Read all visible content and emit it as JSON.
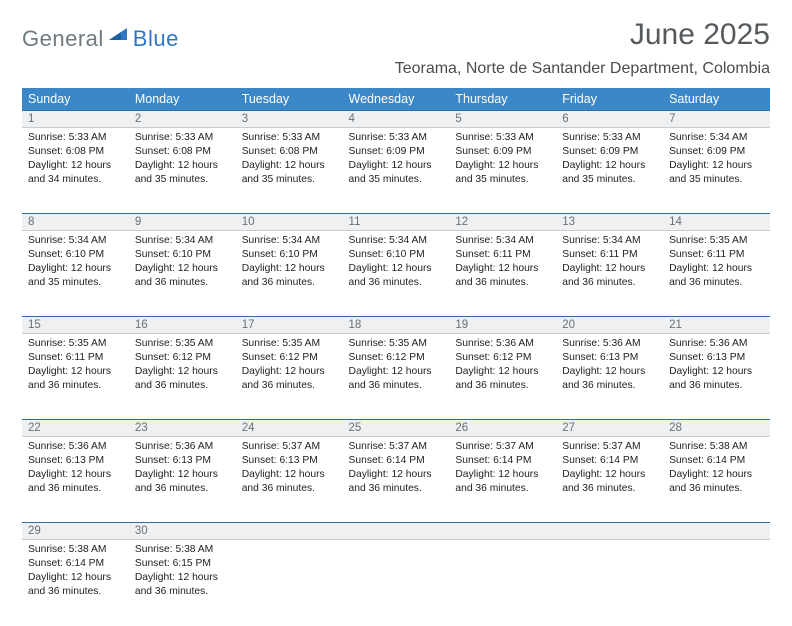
{
  "logo": {
    "text1": "General",
    "text2": "Blue"
  },
  "title": "June 2025",
  "location": "Teorama, Norte de Santander Department, Colombia",
  "weekdays": [
    "Sunday",
    "Monday",
    "Tuesday",
    "Wednesday",
    "Thursday",
    "Friday",
    "Saturday"
  ],
  "weeks": [
    [
      {
        "day": "1",
        "sunrise": "Sunrise: 5:33 AM",
        "sunset": "Sunset: 6:08 PM",
        "day1": "Daylight: 12 hours",
        "day2": "and 34 minutes."
      },
      {
        "day": "2",
        "sunrise": "Sunrise: 5:33 AM",
        "sunset": "Sunset: 6:08 PM",
        "day1": "Daylight: 12 hours",
        "day2": "and 35 minutes."
      },
      {
        "day": "3",
        "sunrise": "Sunrise: 5:33 AM",
        "sunset": "Sunset: 6:08 PM",
        "day1": "Daylight: 12 hours",
        "day2": "and 35 minutes."
      },
      {
        "day": "4",
        "sunrise": "Sunrise: 5:33 AM",
        "sunset": "Sunset: 6:09 PM",
        "day1": "Daylight: 12 hours",
        "day2": "and 35 minutes."
      },
      {
        "day": "5",
        "sunrise": "Sunrise: 5:33 AM",
        "sunset": "Sunset: 6:09 PM",
        "day1": "Daylight: 12 hours",
        "day2": "and 35 minutes."
      },
      {
        "day": "6",
        "sunrise": "Sunrise: 5:33 AM",
        "sunset": "Sunset: 6:09 PM",
        "day1": "Daylight: 12 hours",
        "day2": "and 35 minutes."
      },
      {
        "day": "7",
        "sunrise": "Sunrise: 5:34 AM",
        "sunset": "Sunset: 6:09 PM",
        "day1": "Daylight: 12 hours",
        "day2": "and 35 minutes."
      }
    ],
    [
      {
        "day": "8",
        "sunrise": "Sunrise: 5:34 AM",
        "sunset": "Sunset: 6:10 PM",
        "day1": "Daylight: 12 hours",
        "day2": "and 35 minutes."
      },
      {
        "day": "9",
        "sunrise": "Sunrise: 5:34 AM",
        "sunset": "Sunset: 6:10 PM",
        "day1": "Daylight: 12 hours",
        "day2": "and 36 minutes."
      },
      {
        "day": "10",
        "sunrise": "Sunrise: 5:34 AM",
        "sunset": "Sunset: 6:10 PM",
        "day1": "Daylight: 12 hours",
        "day2": "and 36 minutes."
      },
      {
        "day": "11",
        "sunrise": "Sunrise: 5:34 AM",
        "sunset": "Sunset: 6:10 PM",
        "day1": "Daylight: 12 hours",
        "day2": "and 36 minutes."
      },
      {
        "day": "12",
        "sunrise": "Sunrise: 5:34 AM",
        "sunset": "Sunset: 6:11 PM",
        "day1": "Daylight: 12 hours",
        "day2": "and 36 minutes."
      },
      {
        "day": "13",
        "sunrise": "Sunrise: 5:34 AM",
        "sunset": "Sunset: 6:11 PM",
        "day1": "Daylight: 12 hours",
        "day2": "and 36 minutes."
      },
      {
        "day": "14",
        "sunrise": "Sunrise: 5:35 AM",
        "sunset": "Sunset: 6:11 PM",
        "day1": "Daylight: 12 hours",
        "day2": "and 36 minutes."
      }
    ],
    [
      {
        "day": "15",
        "sunrise": "Sunrise: 5:35 AM",
        "sunset": "Sunset: 6:11 PM",
        "day1": "Daylight: 12 hours",
        "day2": "and 36 minutes."
      },
      {
        "day": "16",
        "sunrise": "Sunrise: 5:35 AM",
        "sunset": "Sunset: 6:12 PM",
        "day1": "Daylight: 12 hours",
        "day2": "and 36 minutes."
      },
      {
        "day": "17",
        "sunrise": "Sunrise: 5:35 AM",
        "sunset": "Sunset: 6:12 PM",
        "day1": "Daylight: 12 hours",
        "day2": "and 36 minutes."
      },
      {
        "day": "18",
        "sunrise": "Sunrise: 5:35 AM",
        "sunset": "Sunset: 6:12 PM",
        "day1": "Daylight: 12 hours",
        "day2": "and 36 minutes."
      },
      {
        "day": "19",
        "sunrise": "Sunrise: 5:36 AM",
        "sunset": "Sunset: 6:12 PM",
        "day1": "Daylight: 12 hours",
        "day2": "and 36 minutes."
      },
      {
        "day": "20",
        "sunrise": "Sunrise: 5:36 AM",
        "sunset": "Sunset: 6:13 PM",
        "day1": "Daylight: 12 hours",
        "day2": "and 36 minutes."
      },
      {
        "day": "21",
        "sunrise": "Sunrise: 5:36 AM",
        "sunset": "Sunset: 6:13 PM",
        "day1": "Daylight: 12 hours",
        "day2": "and 36 minutes."
      }
    ],
    [
      {
        "day": "22",
        "sunrise": "Sunrise: 5:36 AM",
        "sunset": "Sunset: 6:13 PM",
        "day1": "Daylight: 12 hours",
        "day2": "and 36 minutes."
      },
      {
        "day": "23",
        "sunrise": "Sunrise: 5:36 AM",
        "sunset": "Sunset: 6:13 PM",
        "day1": "Daylight: 12 hours",
        "day2": "and 36 minutes."
      },
      {
        "day": "24",
        "sunrise": "Sunrise: 5:37 AM",
        "sunset": "Sunset: 6:13 PM",
        "day1": "Daylight: 12 hours",
        "day2": "and 36 minutes."
      },
      {
        "day": "25",
        "sunrise": "Sunrise: 5:37 AM",
        "sunset": "Sunset: 6:14 PM",
        "day1": "Daylight: 12 hours",
        "day2": "and 36 minutes."
      },
      {
        "day": "26",
        "sunrise": "Sunrise: 5:37 AM",
        "sunset": "Sunset: 6:14 PM",
        "day1": "Daylight: 12 hours",
        "day2": "and 36 minutes."
      },
      {
        "day": "27",
        "sunrise": "Sunrise: 5:37 AM",
        "sunset": "Sunset: 6:14 PM",
        "day1": "Daylight: 12 hours",
        "day2": "and 36 minutes."
      },
      {
        "day": "28",
        "sunrise": "Sunrise: 5:38 AM",
        "sunset": "Sunset: 6:14 PM",
        "day1": "Daylight: 12 hours",
        "day2": "and 36 minutes."
      }
    ],
    [
      {
        "day": "29",
        "sunrise": "Sunrise: 5:38 AM",
        "sunset": "Sunset: 6:14 PM",
        "day1": "Daylight: 12 hours",
        "day2": "and 36 minutes."
      },
      {
        "day": "30",
        "sunrise": "Sunrise: 5:38 AM",
        "sunset": "Sunset: 6:15 PM",
        "day1": "Daylight: 12 hours",
        "day2": "and 36 minutes."
      },
      null,
      null,
      null,
      null,
      null
    ]
  ]
}
